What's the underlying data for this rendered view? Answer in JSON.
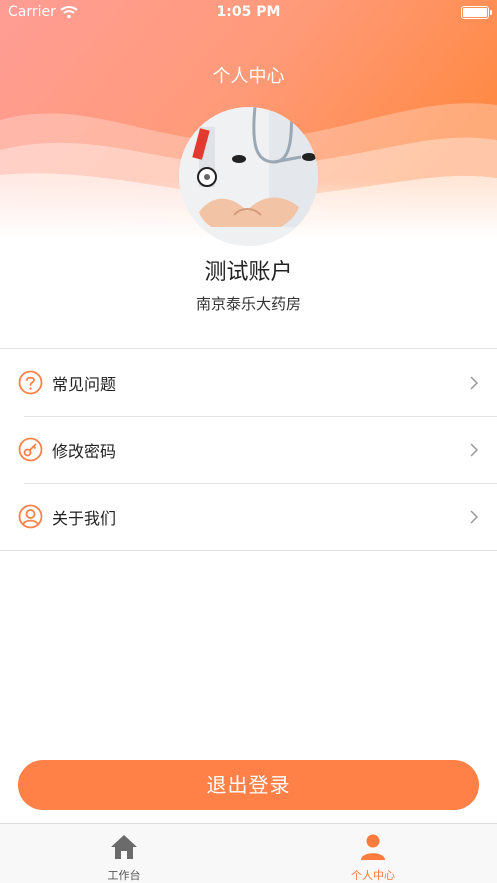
{
  "status_bar": {
    "carrier": "Carrier",
    "time": "1:05 PM"
  },
  "header": {
    "title": "个人中心"
  },
  "profile": {
    "name": "测试账户",
    "organization": "南京泰乐大药房"
  },
  "menu": {
    "items": [
      {
        "label": "常见问题",
        "icon": "question-circle-icon"
      },
      {
        "label": "修改密码",
        "icon": "key-icon"
      },
      {
        "label": "关于我们",
        "icon": "user-circle-icon"
      }
    ]
  },
  "logout": {
    "label": "退出登录"
  },
  "tabbar": {
    "items": [
      {
        "label": "工作台",
        "icon": "home-icon",
        "active": false
      },
      {
        "label": "个人中心",
        "icon": "person-icon",
        "active": true
      }
    ]
  },
  "colors": {
    "accent": "#ff8147",
    "header_top": "#ff9a8a",
    "header_right": "#ff8c4a"
  }
}
